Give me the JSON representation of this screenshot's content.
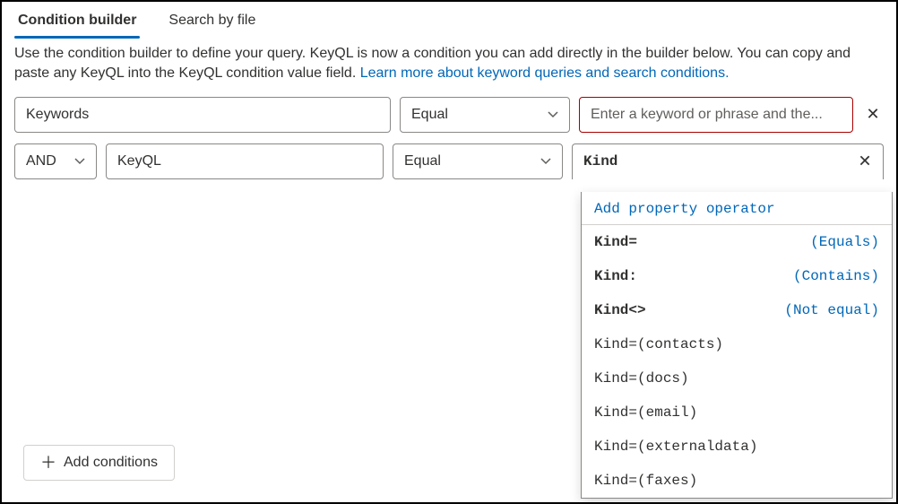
{
  "tabs": {
    "builder": "Condition builder",
    "byfile": "Search by file"
  },
  "description": {
    "text": "Use the condition builder to define your query. KeyQL is now a condition you can add directly in the builder below. You can copy and paste any KeyQL into the KeyQL condition value field. ",
    "link": "Learn more about keyword queries and search conditions."
  },
  "row1": {
    "field": "Keywords",
    "operator": "Equal",
    "placeholder": "Enter a keyword or phrase and the..."
  },
  "row2": {
    "logic": "AND",
    "field": "KeyQL",
    "operator": "Equal",
    "value": "Kind"
  },
  "dropdown": {
    "header": "Add property operator",
    "ops": [
      {
        "k": "Kind=",
        "v": "(Equals)"
      },
      {
        "k": "Kind:",
        "v": "(Contains)"
      },
      {
        "k": "Kind<>",
        "v": "(Not equal)"
      }
    ],
    "values": [
      "Kind=(contacts)",
      "Kind=(docs)",
      "Kind=(email)",
      "Kind=(externaldata)",
      "Kind=(faxes)"
    ]
  },
  "add_button": "Add conditions"
}
